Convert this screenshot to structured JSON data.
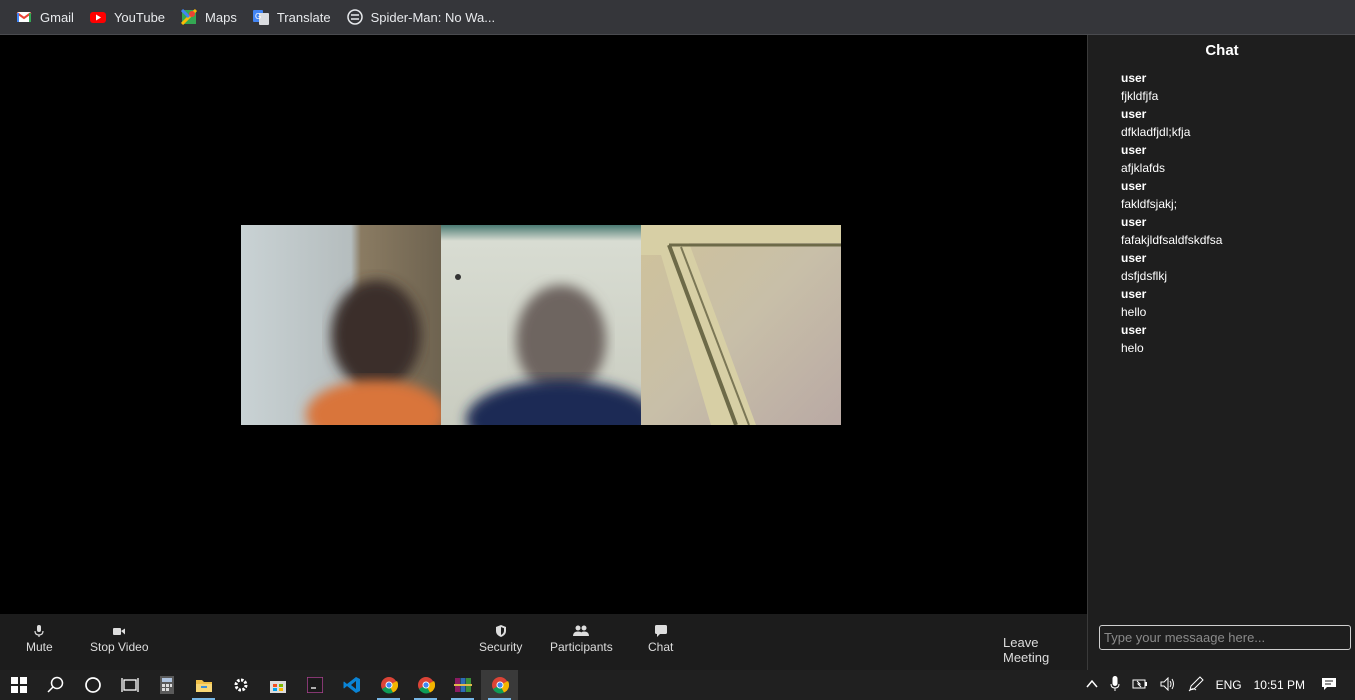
{
  "bookmarks": [
    {
      "label": "Gmail",
      "icon": "gmail-icon"
    },
    {
      "label": "YouTube",
      "icon": "youtube-icon"
    },
    {
      "label": "Maps",
      "icon": "maps-icon"
    },
    {
      "label": "Translate",
      "icon": "translate-icon"
    },
    {
      "label": "Spider-Man: No Wa...",
      "icon": "bookmark-page-icon"
    }
  ],
  "chat": {
    "title": "Chat",
    "messages": [
      {
        "user": "user",
        "text": "fjkldfjfa"
      },
      {
        "user": "user",
        "text": "dfkladfjdl;kfja"
      },
      {
        "user": "user",
        "text": "afjklafds"
      },
      {
        "user": "user",
        "text": "fakldfsjakj;"
      },
      {
        "user": "user",
        "text": "fafakjldfsaldfskdfsa"
      },
      {
        "user": "user",
        "text": "dsfjdsflkj"
      },
      {
        "user": "user",
        "text": "hello"
      },
      {
        "user": "user",
        "text": "helo"
      }
    ],
    "input_placeholder": "Type your messaage here..."
  },
  "controls": {
    "mute": "Mute",
    "stop_video": "Stop Video",
    "security": "Security",
    "participants": "Participants",
    "chat": "Chat",
    "leave": "Leave Meeting"
  },
  "tray": {
    "language": "ENG",
    "time": "10:51 PM"
  }
}
